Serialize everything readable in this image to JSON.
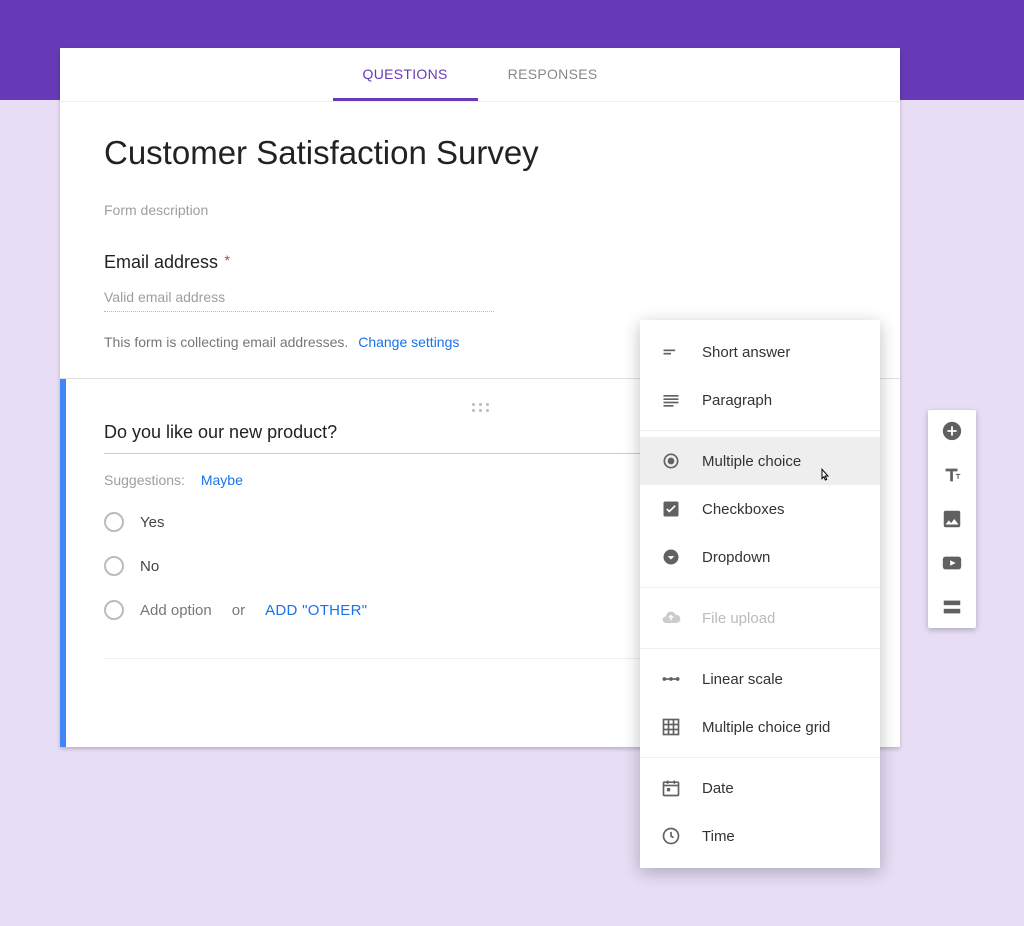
{
  "tabs": {
    "questions": "QUESTIONS",
    "responses": "RESPONSES"
  },
  "form": {
    "title": "Customer Satisfaction Survey",
    "description_placeholder": "Form description"
  },
  "email": {
    "label": "Email address",
    "placeholder": "Valid email address",
    "note": "This form is collecting email addresses.",
    "change_link": "Change settings"
  },
  "question": {
    "title": "Do you like our new product?",
    "suggestions_label": "Suggestions:",
    "suggestion": "Maybe",
    "options": [
      "Yes",
      "No"
    ],
    "add_option": "Add option",
    "or": "or",
    "add_other": "ADD \"OTHER\""
  },
  "type_menu": {
    "short_answer": "Short answer",
    "paragraph": "Paragraph",
    "multiple_choice": "Multiple choice",
    "checkboxes": "Checkboxes",
    "dropdown": "Dropdown",
    "file_upload": "File upload",
    "linear_scale": "Linear scale",
    "grid": "Multiple choice grid",
    "date": "Date",
    "time": "Time"
  }
}
